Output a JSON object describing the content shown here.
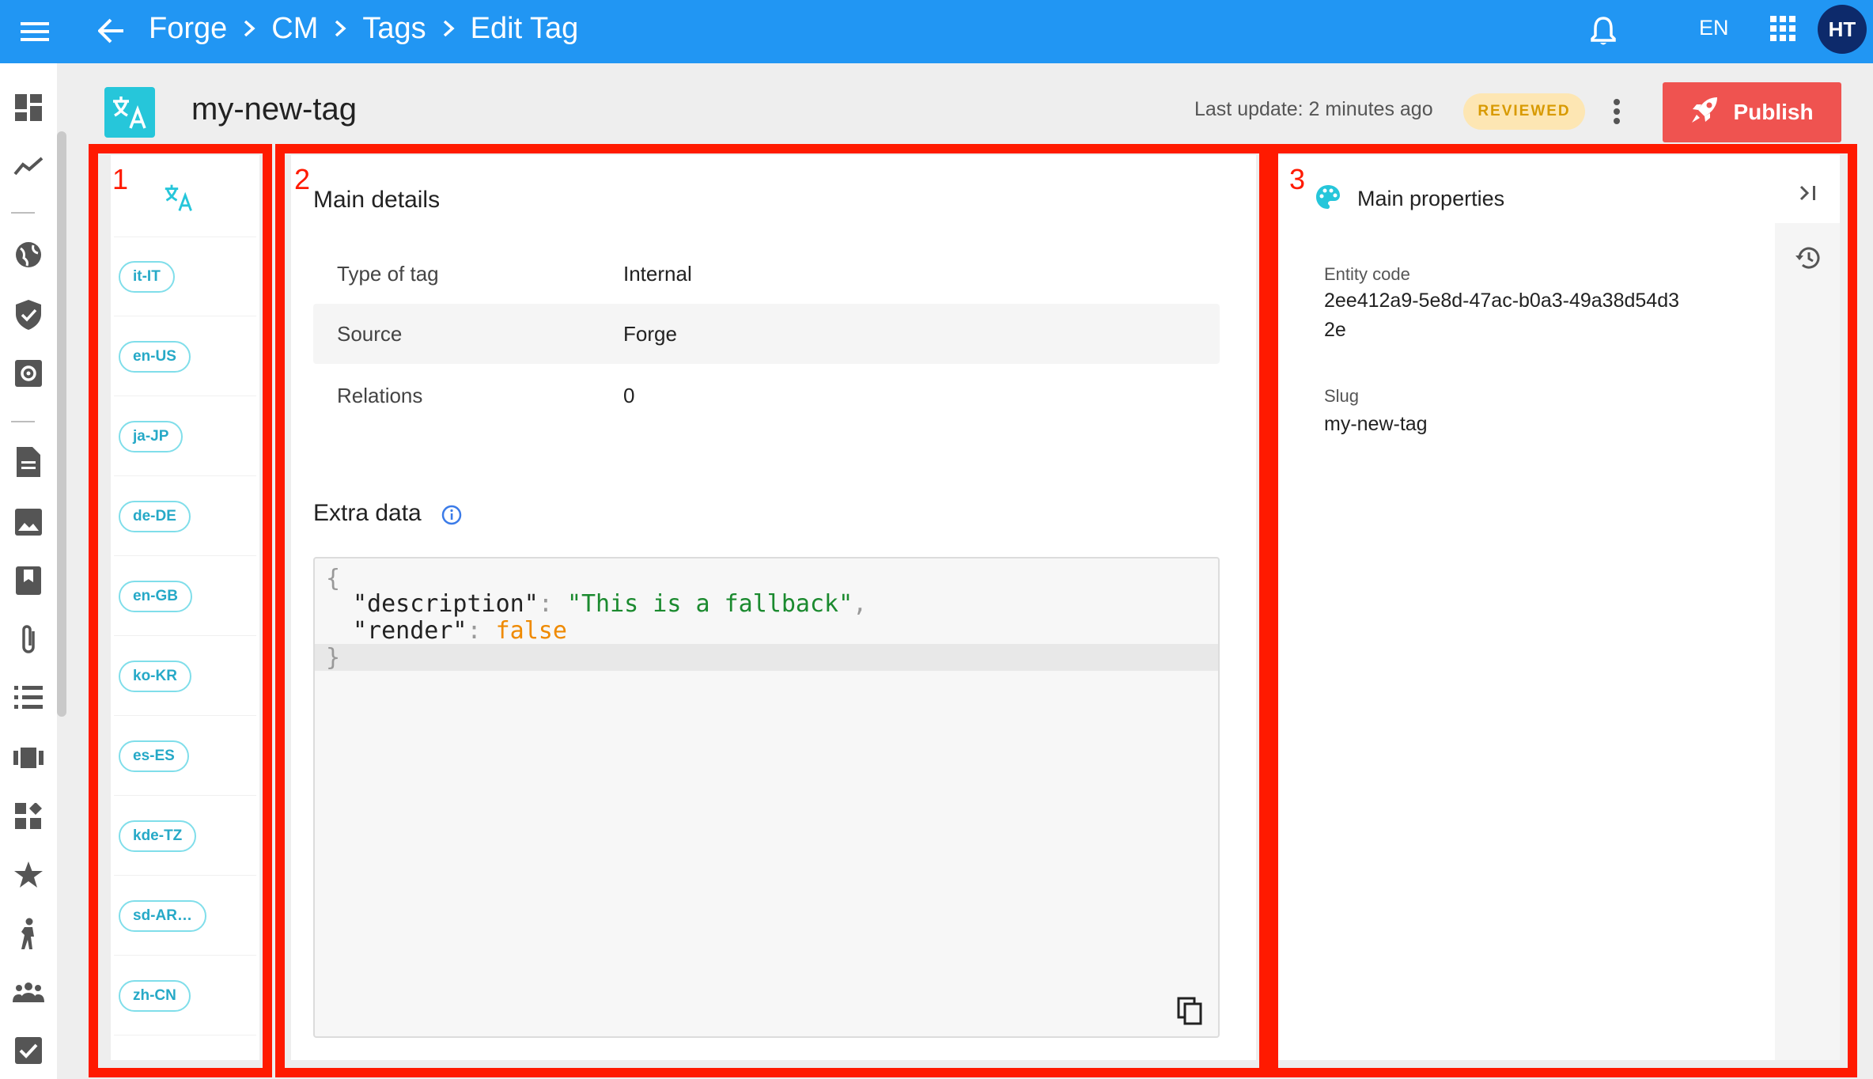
{
  "topbar": {
    "breadcrumbs": [
      "Forge",
      "CM",
      "Tags",
      "Edit Tag"
    ],
    "language": "EN",
    "avatar_initials": "HT",
    "bg_color": "#2196f3"
  },
  "rail": {
    "icons": [
      "dashboard-icon",
      "analytics-icon",
      "globe-icon",
      "shield-check-icon",
      "settings-icon",
      "document-icon",
      "image-icon",
      "bookmark-icon",
      "attachment-icon",
      "list-icon",
      "carousel-icon",
      "widgets-icon",
      "star-icon",
      "person-icon",
      "group-icon",
      "checkbox-icon"
    ]
  },
  "header": {
    "title": "my-new-tag",
    "last_update": "Last update: 2 minutes ago",
    "status_badge": "REVIEWED",
    "publish_label": "Publish",
    "publish_color": "#ef5350"
  },
  "annotations": [
    "1",
    "2",
    "3"
  ],
  "languages": [
    "it-IT",
    "en-US",
    "ja-JP",
    "de-DE",
    "en-GB",
    "ko-KR",
    "es-ES",
    "kde-TZ",
    "sd-AR…",
    "zh-CN"
  ],
  "main_details": {
    "title": "Main details",
    "rows": [
      {
        "label": "Type of tag",
        "value": "Internal"
      },
      {
        "label": "Source",
        "value": "Forge"
      },
      {
        "label": "Relations",
        "value": "0"
      }
    ]
  },
  "extra_data": {
    "title": "Extra data",
    "open_brace": "{",
    "close_brace": "}",
    "entries": [
      {
        "key": "\"description\"",
        "value": "\"This is a fallback\"",
        "trail": ","
      },
      {
        "key": "\"render\"",
        "value": "false",
        "trail": ""
      }
    ]
  },
  "properties": {
    "title": "Main properties",
    "entity_code_label": "Entity code",
    "entity_code": "2ee412a9-5e8d-47ac-b0a3-49a38d54d32e",
    "slug_label": "Slug",
    "slug": "my-new-tag"
  }
}
